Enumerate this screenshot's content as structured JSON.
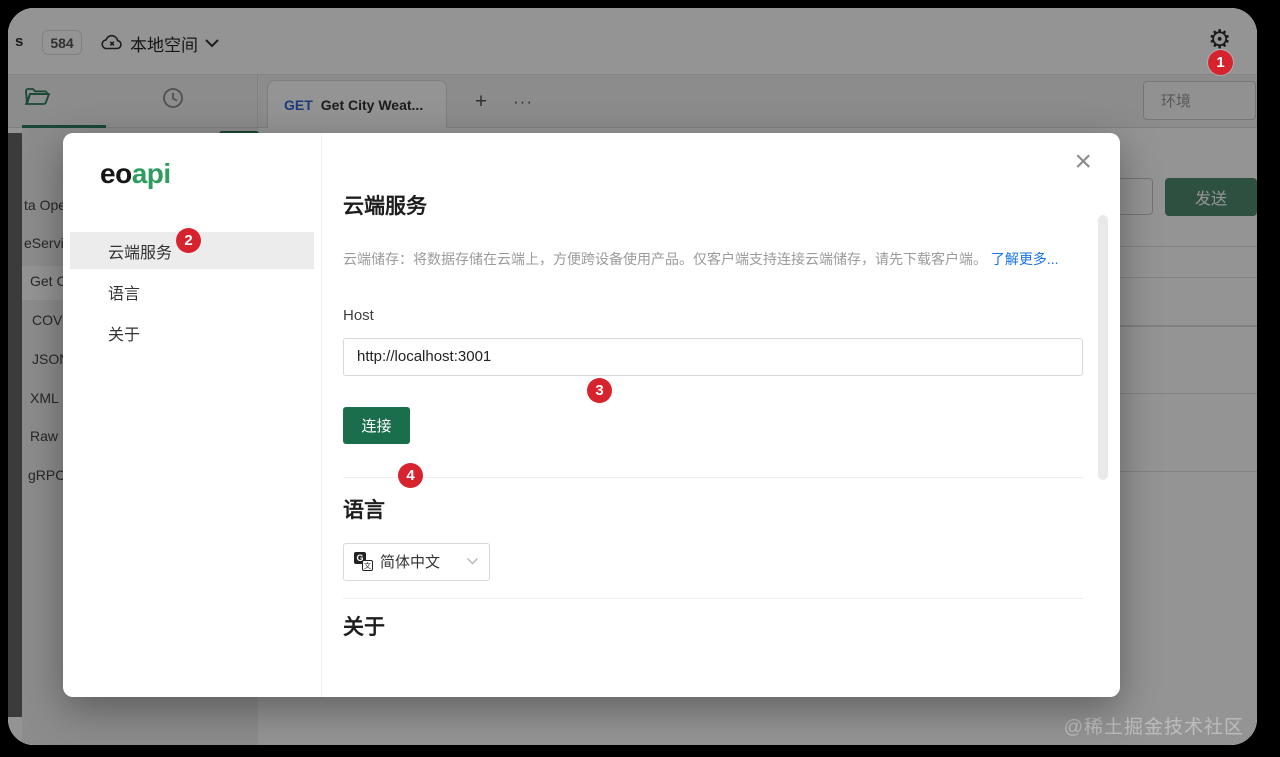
{
  "topbar": {
    "partial_left_text": "s",
    "count_badge": "584",
    "workspace_label": "本地空间"
  },
  "tabbar": {
    "active_tab": {
      "method": "GET",
      "label": "Get City Weat..."
    },
    "new_tab_button": "+",
    "more_tabs_button": "···",
    "environment_placeholder": "环境"
  },
  "request_bar": {
    "send_label": "发送"
  },
  "background_list": {
    "items": [
      "ta Ope",
      "eServic",
      "Get C",
      "COVI",
      "JSON",
      "XML",
      "Raw",
      "gRPC"
    ]
  },
  "modal": {
    "logo": {
      "prefix": "eo",
      "suffix": "api"
    },
    "menu": [
      {
        "label": "云端服务",
        "badge": "2"
      },
      {
        "label": "语言"
      },
      {
        "label": "关于"
      }
    ],
    "close_icon": "×",
    "cloud_section": {
      "title": "云端服务",
      "description": "云端储存：将数据存储在云端上，方便跨设备使用产品。仅客户端支持连接云端储存，请先下载客户端。",
      "link": "了解更多...",
      "host_label": "Host",
      "host_value": "http://localhost:3001",
      "connect_label": "连接"
    },
    "language_section": {
      "title": "语言",
      "selected_language": "简体中文",
      "translate_icon_g": "G",
      "translate_icon_wen": "文"
    },
    "about_section": {
      "title": "关于"
    }
  },
  "annotations": {
    "step1": "1",
    "step2": "2",
    "step3": "3",
    "step4": "4"
  },
  "icons": {
    "gear": "⚙"
  },
  "watermark": "@稀土掘金技术社区",
  "colors": {
    "brand_green": "#2f9c5f",
    "primary_button_green": "#1a6e4c",
    "badge_red": "#d6232e",
    "link_blue": "#1a73e8",
    "method_get_blue": "#3567d6"
  }
}
